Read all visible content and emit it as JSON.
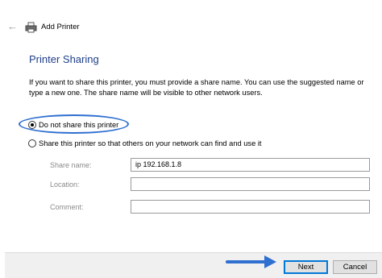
{
  "window": {
    "title": "Add Printer",
    "back_icon": "back-arrow-icon",
    "app_icon": "printer-icon"
  },
  "page": {
    "heading": "Printer Sharing",
    "description": "If you want to share this printer, you must provide a share name. You can use the suggested name or type a new one. The share name will be visible to other network users."
  },
  "options": {
    "do_not_share_label": "Do not share this printer",
    "share_label": "Share this printer so that others on your network can find and use it",
    "selected": "do_not_share"
  },
  "fields": {
    "share_name_label": "Share name:",
    "share_name_value": "ip 192.168.1.8",
    "location_label": "Location:",
    "location_value": "",
    "comment_label": "Comment:",
    "comment_value": ""
  },
  "footer": {
    "next_label": "Next",
    "cancel_label": "Cancel"
  },
  "colors": {
    "heading": "#1f3f8a",
    "highlight": "#2e6fd0",
    "primary_button_border": "#0078d7"
  }
}
